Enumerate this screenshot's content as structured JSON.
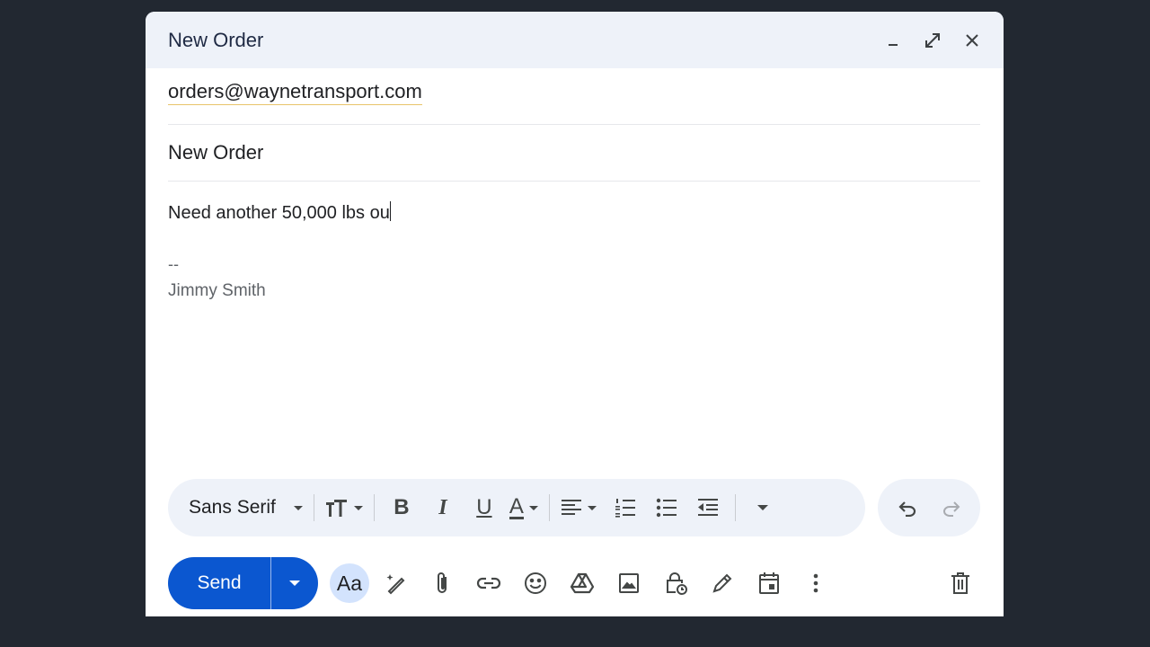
{
  "compose": {
    "title": "New Order",
    "to": "orders@waynetransport.com",
    "subject": "New Order",
    "body_text": "Need another 50,000 lbs ou",
    "signature_dash": "--",
    "signature_name": "Jimmy Smith"
  },
  "formatting": {
    "font": "Sans Serif",
    "bold_glyph": "B",
    "italic_glyph": "I",
    "underline_glyph": "U",
    "text_color_glyph": "A",
    "size_glyph": "TT"
  },
  "bottom": {
    "send_label": "Send",
    "aa_label": "Aa"
  },
  "colors": {
    "accent": "#0b57d0",
    "header_bg": "#eef2f9",
    "backdrop": "#222831"
  }
}
